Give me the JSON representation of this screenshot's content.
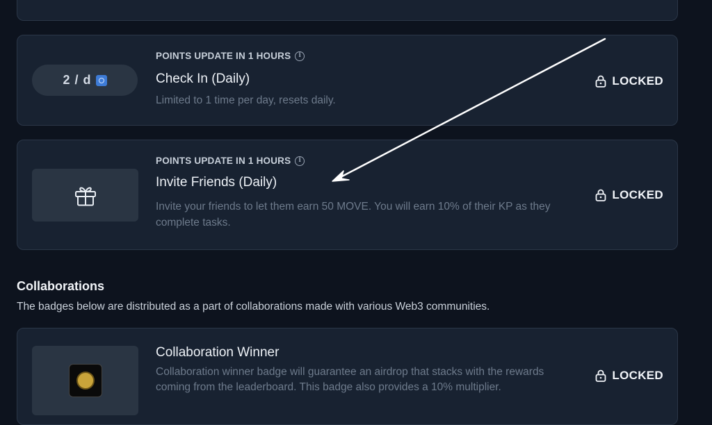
{
  "cards": {
    "checkin": {
      "pill_label": "2 / d",
      "points_update": "POINTS UPDATE IN 1 HOURS",
      "title": "Check In (Daily)",
      "description": "Limited to 1 time per day, resets daily.",
      "status": "LOCKED"
    },
    "invite": {
      "points_update": "POINTS UPDATE IN 1 HOURS",
      "title": "Invite Friends (Daily)",
      "description": "Invite your friends to let them earn 50 MOVE. You will earn 10% of their KP as they complete tasks.",
      "status": "LOCKED"
    },
    "collab": {
      "title": "Collaboration Winner",
      "description": "Collaboration winner badge will guarantee an airdrop that stacks with the rewards coming from the leaderboard. This badge also provides a 10% multiplier.",
      "status": "LOCKED"
    }
  },
  "collaborations": {
    "title": "Collaborations",
    "description": "The badges below are distributed as a part of collaborations made with various Web3 communities."
  },
  "icons": {
    "info": "info-icon",
    "lock": "lock-icon",
    "gift": "gift-icon",
    "badge": "collaboration-badge-image",
    "points": "points-token-icon"
  },
  "colors": {
    "background": "#0d131e",
    "card": "#182231",
    "card_border": "#2b3748",
    "muted_text": "#6e7b8c",
    "points_icon": "#3d7bd6"
  }
}
